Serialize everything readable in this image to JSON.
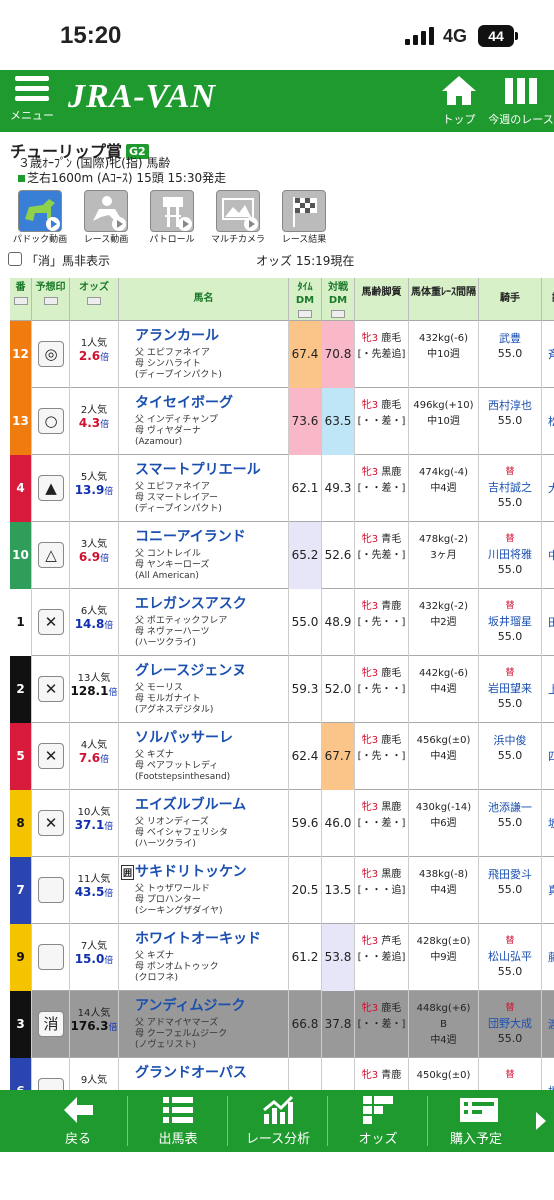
{
  "status": {
    "time": "15:20",
    "network": "4G",
    "battery": "44"
  },
  "topbar": {
    "menu_label": "メニュー",
    "logo": "JRA-VAN",
    "top_label": "トップ",
    "week_label": "今週のレース"
  },
  "race": {
    "name": "チューリップ賞",
    "grade": "G2",
    "line1": "３歳ｵｰﾌﾟﾝ (国際)牝(指) 馬齢",
    "line2": "芝右1600m (Aｺｰｽ) 15頭 15:30発走"
  },
  "videos": [
    "パドック動画",
    "レース動画",
    "パトロール",
    "マルチカメラ",
    "レース結果"
  ],
  "options": {
    "scratch_label": "「消」馬非表示",
    "odds_time": "オッズ 15:19現在"
  },
  "header": {
    "num": "番",
    "mark": "予想印",
    "odds": "オッズ",
    "name": "馬名",
    "time_dm": "ﾀｲﾑDM",
    "vs_dm": "対戦DM",
    "age": "馬齢脚質",
    "weight": "馬体重ﾚｰｽ間隔",
    "jockey": "騎手",
    "extra": "調"
  },
  "horses": [
    {
      "num": "12",
      "color": "#f07c10",
      "mark": "◎",
      "pop": "1人気",
      "odds": "2.6",
      "odds_color": "red",
      "name": "アランカール",
      "sire": "父 エピファネイア",
      "dam": "母 シンハライト",
      "damsire": "(ディープインパクト)",
      "tdm": "67.4",
      "tdm_bg": "#fbc58a",
      "vdm": "70.8",
      "vdm_bg": "#f8b8c8",
      "sex": "牝3 鹿毛",
      "style": "[・先差追]",
      "weight": "432kg(-6)",
      "interval": "中10週",
      "rep": "",
      "jockey": "武豊",
      "kg": "55.0",
      "ext": "斉"
    },
    {
      "num": "13",
      "color": "#f07c10",
      "mark": "○",
      "pop": "2人気",
      "odds": "4.3",
      "odds_color": "red",
      "name": "タイセイボーグ",
      "sire": "父 インディチャンプ",
      "dam": "母 ヴィヤダーナ",
      "damsire": "(Azamour)",
      "tdm": "73.6",
      "tdm_bg": "#f8b8c8",
      "vdm": "63.5",
      "vdm_bg": "#bfe6f6",
      "sex": "牝3 鹿毛",
      "style": "[・・差・]",
      "weight": "496kg(+10)",
      "interval": "中10週",
      "rep": "",
      "jockey": "西村淳也",
      "kg": "55.0",
      "ext": "松"
    },
    {
      "num": "4",
      "color": "#d81b3c",
      "mark": "▲",
      "pop": "5人気",
      "odds": "13.9",
      "odds_color": "blue",
      "name": "スマートプリエール",
      "sire": "父 エピファネイア",
      "dam": "母 スマートレイアー",
      "damsire": "(ディープインパクト)",
      "tdm": "62.1",
      "tdm_bg": "",
      "vdm": "49.3",
      "vdm_bg": "",
      "sex": "牝3 黒鹿",
      "style": "[・・差・]",
      "weight": "474kg(-4)",
      "interval": "中4週",
      "rep": "替",
      "jockey": "吉村誠之",
      "kg": "55.0",
      "ext": "大"
    },
    {
      "num": "10",
      "color": "#2e9e5a",
      "mark": "△",
      "pop": "3人気",
      "odds": "6.9",
      "odds_color": "red",
      "name": "コニーアイランド",
      "sire": "父 コントレイル",
      "dam": "母 ヤンキーローズ",
      "damsire": "(All American)",
      "tdm": "65.2",
      "tdm_bg": "#e6e6f8",
      "vdm": "52.6",
      "vdm_bg": "",
      "sex": "牝3 青毛",
      "style": "[・先差・]",
      "weight": "478kg(-2)",
      "interval": "3ヶ月",
      "rep": "替",
      "jockey": "川田将雅",
      "kg": "55.0",
      "ext": "中"
    },
    {
      "num": "1",
      "color": "#ffffff",
      "mark": "✕",
      "pop": "6人気",
      "odds": "14.8",
      "odds_color": "blue",
      "name": "エレガンスアスク",
      "sire": "父 ポエティックフレア",
      "dam": "母 ネヴァーハーツ",
      "damsire": "(ハーツクライ)",
      "tdm": "55.0",
      "tdm_bg": "",
      "vdm": "48.9",
      "vdm_bg": "",
      "sex": "牝3 青鹿",
      "style": "[・先・・]",
      "weight": "432kg(-2)",
      "interval": "中2週",
      "rep": "替",
      "jockey": "坂井瑠星",
      "kg": "55.0",
      "ext": "田"
    },
    {
      "num": "2",
      "color": "#111111",
      "mark": "✕",
      "pop": "13人気",
      "odds": "128.1",
      "odds_color": "blk",
      "name": "グレースジェンヌ",
      "sire": "父 モーリス",
      "dam": "母 モルガナイト",
      "damsire": "(アグネスデジタル)",
      "tdm": "59.3",
      "tdm_bg": "",
      "vdm": "52.0",
      "vdm_bg": "",
      "sex": "牝3 鹿毛",
      "style": "[・先・・]",
      "weight": "442kg(-6)",
      "interval": "中4週",
      "rep": "替",
      "jockey": "岩田望来",
      "kg": "55.0",
      "ext": "上"
    },
    {
      "num": "5",
      "color": "#d81b3c",
      "mark": "✕",
      "pop": "4人気",
      "odds": "7.6",
      "odds_color": "red",
      "name": "ソルパッサーレ",
      "sire": "父 キズナ",
      "dam": "母 ペアフットレディ",
      "damsire": "(Footstepsinthesand)",
      "tdm": "62.4",
      "tdm_bg": "",
      "vdm": "67.7",
      "vdm_bg": "#fbc58a",
      "sex": "牝3 鹿毛",
      "style": "[・先・・]",
      "weight": "456kg(±0)",
      "interval": "中4週",
      "rep": "",
      "jockey": "浜中俊",
      "kg": "55.0",
      "ext": "四"
    },
    {
      "num": "8",
      "color": "#f5c400",
      "mark": "✕",
      "pop": "10人気",
      "odds": "37.1",
      "odds_color": "blue",
      "name": "エイズルブルーム",
      "sire": "父 リオンディーズ",
      "dam": "母 ベイシャフェリシタ",
      "damsire": "(ハーツクライ)",
      "tdm": "59.6",
      "tdm_bg": "",
      "vdm": "46.0",
      "vdm_bg": "",
      "sex": "牝3 黒鹿",
      "style": "[・・差・]",
      "weight": "430kg(-14)",
      "interval": "中6週",
      "rep": "",
      "jockey": "池添謙一",
      "kg": "55.0",
      "ext": "坂"
    },
    {
      "num": "7",
      "color": "#2a45b0",
      "mark": "",
      "pop": "11人気",
      "odds": "43.5",
      "odds_color": "blue",
      "name": "サキドリトッケン",
      "badge": "囲",
      "sire": "父 トゥザワールド",
      "dam": "母 プロハンター",
      "damsire": "(シーキングザダイヤ)",
      "tdm": "20.5",
      "tdm_bg": "",
      "vdm": "13.5",
      "vdm_bg": "",
      "sex": "牝3 黒鹿",
      "style": "[・・・追]",
      "weight": "438kg(-8)",
      "interval": "中4週",
      "rep": "",
      "jockey": "飛田愛斗",
      "kg": "55.0",
      "ext": "真"
    },
    {
      "num": "9",
      "color": "#f5c400",
      "mark": "",
      "pop": "7人気",
      "odds": "15.0",
      "odds_color": "blue",
      "name": "ホワイトオーキッド",
      "sire": "父 キズナ",
      "dam": "母 ボンオムトゥック",
      "damsire": "(クロフネ)",
      "tdm": "61.2",
      "tdm_bg": "",
      "vdm": "53.8",
      "vdm_bg": "#e6e6f8",
      "sex": "牝3 芦毛",
      "style": "[・・差追]",
      "weight": "428kg(±0)",
      "interval": "中9週",
      "rep": "替",
      "jockey": "松山弘平",
      "kg": "55.0",
      "ext": "藤"
    },
    {
      "num": "3",
      "color": "#111111",
      "mark": "消",
      "pop": "14人気",
      "odds": "176.3",
      "odds_color": "blk",
      "name": "アンディムジーク",
      "sire": "父 アドマイヤマーズ",
      "dam": "母 クーフェルムジーク",
      "damsire": "(ノヴェリスト)",
      "tdm": "66.8",
      "tdm_bg": "",
      "vdm": "37.8",
      "vdm_bg": "",
      "sex": "牝3 鹿毛",
      "style": "[・・差・]",
      "weight": "448kg(+6)",
      "weight2": "B",
      "interval": "中4週",
      "rep": "替",
      "jockey": "団野大成",
      "kg": "55.0",
      "ext": "渡",
      "scratched": true
    },
    {
      "num": "6",
      "color": "#2a45b0",
      "mark": "",
      "pop": "9人気",
      "odds": "",
      "odds_color": "blue",
      "name": "グランドオーパス",
      "sire": "",
      "dam": "",
      "damsire": "",
      "tdm": "",
      "tdm_bg": "",
      "vdm": "",
      "vdm_bg": "",
      "sex": "牝3 青鹿",
      "style": "",
      "weight": "450kg(±0)",
      "interval": "",
      "rep": "替",
      "jockey": "",
      "kg": "",
      "ext": "橋"
    }
  ],
  "bottom": {
    "back": "戻る",
    "entries": "出馬表",
    "analysis": "レース分析",
    "odds": "オッズ",
    "buy": "購入予定"
  }
}
